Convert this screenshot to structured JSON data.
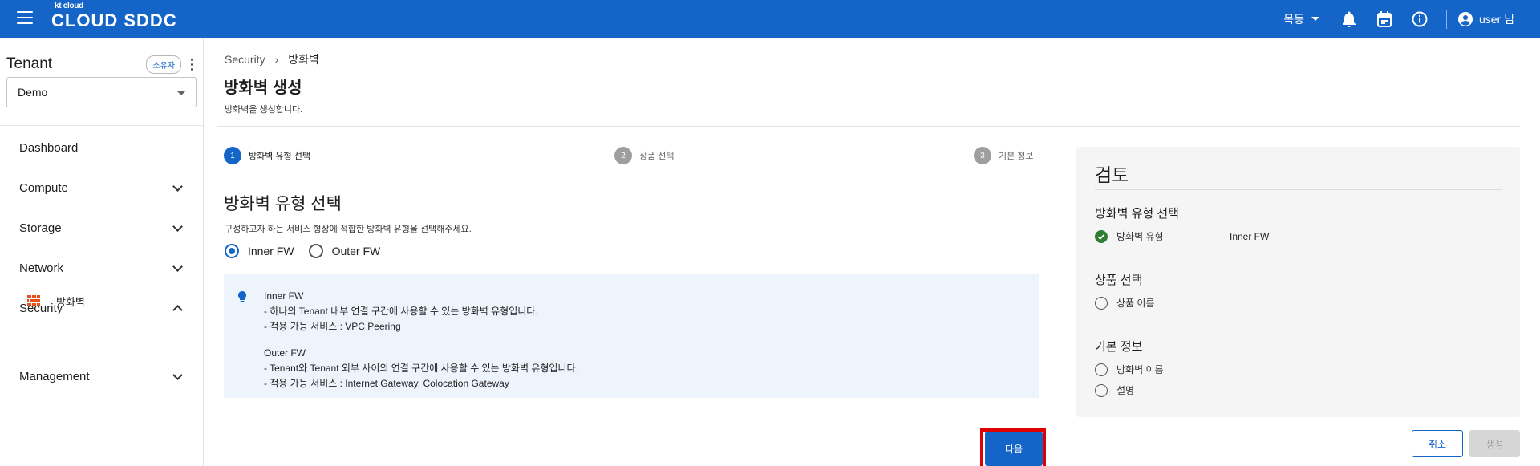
{
  "header": {
    "logo_small": "kt cloud",
    "logo_big": "CLOUD SDDC",
    "region": "목동",
    "user": "user 님",
    "icons": [
      "menu-icon",
      "bell-icon",
      "calendar-icon",
      "info-icon",
      "account-icon"
    ]
  },
  "sidebar": {
    "tenant_title": "Tenant",
    "owner_badge": "소유자",
    "tenant_selected": "Demo",
    "items": [
      {
        "label": "Dashboard"
      },
      {
        "label": "Compute"
      },
      {
        "label": "Storage"
      },
      {
        "label": "Network"
      },
      {
        "label": "Security"
      },
      {
        "label": "Management"
      }
    ],
    "sub_item": "방화벽"
  },
  "breadcrumb": {
    "parent": "Security",
    "current": "방화벽"
  },
  "page": {
    "title": "방화벽 생성",
    "subtitle": "방화벽을 생성합니다."
  },
  "stepper": [
    {
      "num": "1",
      "label": "방화벽 유형 선택",
      "active": true
    },
    {
      "num": "2",
      "label": "상품 선택",
      "active": false
    },
    {
      "num": "3",
      "label": "기본 정보",
      "active": false
    }
  ],
  "section": {
    "title": "방화벽 유형 선택",
    "desc": "구성하고자 하는 서비스 형상에 적합한 방화벽 유형을 선택해주세요.",
    "options": [
      "Inner FW",
      "Outer FW"
    ],
    "selected": "Inner FW"
  },
  "info": {
    "inner_head": "Inner FW",
    "inner_line1": "- 하나의 Tenant 내부 연결 구간에 사용할 수 있는 방화벽 유형입니다.",
    "inner_line2": "- 적용 가능 서비스 : VPC Peering",
    "outer_head": "Outer FW",
    "outer_line1": "- Tenant와 Tenant 외부 사이의 연결 구간에 사용할 수 있는 방화벽 유형입니다.",
    "outer_line2": "- 적용 가능 서비스 : Internet Gateway, Colocation Gateway"
  },
  "buttons": {
    "next": "다음",
    "cancel": "취소",
    "create": "생성"
  },
  "review": {
    "title": "검토",
    "groups": [
      {
        "head": "방화벽 유형 선택",
        "rows": [
          {
            "label": "방화벽 유형",
            "value": "Inner FW",
            "done": true
          }
        ]
      },
      {
        "head": "상품 선택",
        "rows": [
          {
            "label": "상품 이름",
            "value": "",
            "done": false
          }
        ]
      },
      {
        "head": "기본 정보",
        "rows": [
          {
            "label": "방화벽 이름",
            "value": "",
            "done": false
          },
          {
            "label": "설명",
            "value": "",
            "done": false
          }
        ]
      }
    ]
  },
  "colors": {
    "primary": "#1565c8",
    "highlight": "#e00000",
    "panel": "#f5f5f5",
    "info_bg": "#eef4fb"
  }
}
